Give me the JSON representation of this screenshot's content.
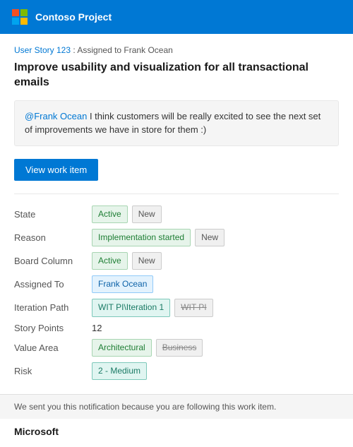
{
  "header": {
    "title": "Contoso Project",
    "logo_alt": "Microsoft logo"
  },
  "breadcrumb": {
    "link_text": "User Story 123",
    "separator": " : ",
    "suffix": "Assigned to Frank Ocean"
  },
  "work_item": {
    "title": "Improve usability and visualization for all transactional emails"
  },
  "comment": {
    "mention": "@Frank Ocean",
    "text": " I think customers will be really excited to see the next set of improvements we have in store for them :)"
  },
  "button": {
    "label": "View work item"
  },
  "fields": [
    {
      "label": "State",
      "values": [
        {
          "text": "Active",
          "style": "green"
        },
        {
          "text": "New",
          "style": "gray"
        }
      ]
    },
    {
      "label": "Reason",
      "values": [
        {
          "text": "Implementation started",
          "style": "green"
        },
        {
          "text": "New",
          "style": "gray"
        }
      ]
    },
    {
      "label": "Board Column",
      "values": [
        {
          "text": "Active",
          "style": "green"
        },
        {
          "text": "New",
          "style": "gray"
        }
      ]
    },
    {
      "label": "Assigned To",
      "values": [
        {
          "text": "Frank Ocean",
          "style": "blue"
        }
      ]
    },
    {
      "label": "Iteration Path",
      "values": [
        {
          "text": "WIT PI\\Iteration 1",
          "style": "teal"
        },
        {
          "text": "WIT PI",
          "style": "strikethrough"
        }
      ]
    },
    {
      "label": "Story Points",
      "values": [
        {
          "text": "12",
          "style": "plain"
        }
      ]
    },
    {
      "label": "Value Area",
      "values": [
        {
          "text": "Architectural",
          "style": "green"
        },
        {
          "text": "Business",
          "style": "strikethrough"
        }
      ]
    },
    {
      "label": "Risk",
      "values": [
        {
          "text": "2 - Medium",
          "style": "teal"
        }
      ]
    }
  ],
  "footer": {
    "note": "We sent you this notification because you are following this work item.",
    "brand": "Microsoft"
  }
}
